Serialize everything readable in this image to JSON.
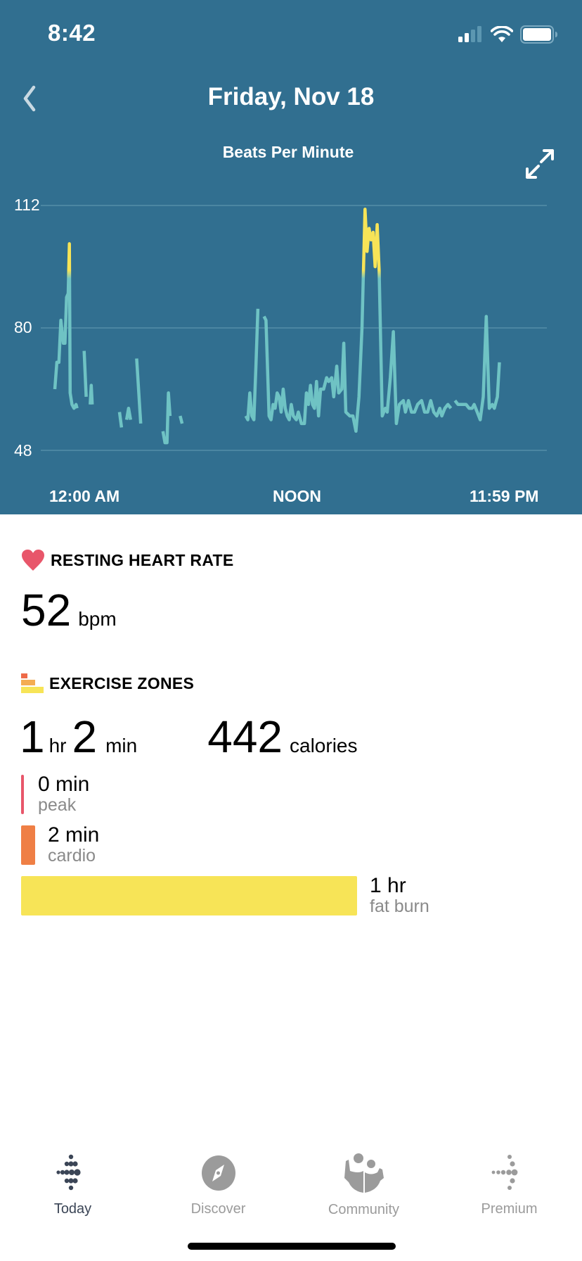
{
  "status_bar": {
    "time": "8:42",
    "signal_icon": "cellular-signal-icon",
    "wifi_icon": "wifi-icon",
    "battery_icon": "battery-icon"
  },
  "header": {
    "title": "Friday, Nov 18",
    "back_icon": "chevron-left-icon",
    "expand_icon": "expand-icon"
  },
  "colors": {
    "hero_bg": "#316f90",
    "line": "#6fc3c4",
    "fat_burn": "#f7e457",
    "cardio": "#ef7f45",
    "peak": "#e8566a",
    "heart": "#e8566a",
    "grid": "#5b93ad"
  },
  "chart_data": {
    "type": "line",
    "title": "Beats Per Minute",
    "xlabel": "",
    "ylabel": "Beats Per Minute",
    "ylim": [
      48,
      112
    ],
    "xlim": [
      0,
      24
    ],
    "yticks": [
      112,
      80,
      48
    ],
    "xtick_labels": [
      "12:00 AM",
      "NOON",
      "11:59 PM"
    ],
    "xtick_hours": [
      0,
      12,
      24
    ],
    "grid": true,
    "fat_burn_threshold_bpm": 94,
    "series": [
      {
        "name": "heart rate",
        "segments": [
          [
            [
              0.0,
              64
            ],
            [
              0.1,
              71
            ],
            [
              0.2,
              71
            ],
            [
              0.3,
              82
            ],
            [
              0.42,
              76
            ],
            [
              0.5,
              76
            ],
            [
              0.58,
              88
            ],
            [
              0.66,
              89
            ],
            [
              0.72,
              102
            ],
            [
              0.76,
              63
            ],
            [
              0.85,
              60
            ],
            [
              0.95,
              59
            ],
            [
              1.05,
              60
            ],
            [
              1.1,
              59
            ]
          ],
          [
            [
              1.45,
              74
            ],
            [
              1.55,
              62
            ]
          ],
          [
            [
              1.75,
              60
            ],
            [
              1.8,
              65
            ],
            [
              1.85,
              60
            ]
          ],
          [
            [
              3.2,
              58
            ],
            [
              3.3,
              54
            ]
          ],
          [
            [
              3.55,
              56
            ],
            [
              3.65,
              59
            ],
            [
              3.75,
              56
            ]
          ],
          [
            [
              4.05,
              72
            ],
            [
              4.25,
              55
            ]
          ],
          [
            [
              5.35,
              53
            ],
            [
              5.45,
              50
            ],
            [
              5.55,
              50
            ],
            [
              5.62,
              63
            ],
            [
              5.7,
              57
            ]
          ],
          [
            [
              6.2,
              57
            ],
            [
              6.3,
              55
            ]
          ],
          [
            [
              9.45,
              57
            ],
            [
              9.55,
              56
            ],
            [
              9.65,
              63
            ],
            [
              9.75,
              57
            ],
            [
              9.85,
              56
            ],
            [
              9.95,
              70
            ],
            [
              10.05,
              85
            ]
          ],
          [
            [
              10.35,
              83
            ],
            [
              10.45,
              82
            ],
            [
              10.6,
              57
            ],
            [
              10.7,
              56
            ],
            [
              10.8,
              60
            ],
            [
              10.9,
              59
            ],
            [
              11.0,
              63
            ],
            [
              11.1,
              62
            ],
            [
              11.2,
              58
            ],
            [
              11.3,
              64
            ],
            [
              11.4,
              59
            ],
            [
              11.5,
              57
            ],
            [
              11.6,
              56
            ],
            [
              11.7,
              60
            ],
            [
              11.8,
              57
            ],
            [
              11.95,
              56
            ],
            [
              12.05,
              58
            ],
            [
              12.2,
              55
            ],
            [
              12.35,
              55
            ],
            [
              12.45,
              63
            ],
            [
              12.55,
              60
            ],
            [
              12.65,
              65
            ],
            [
              12.75,
              60
            ],
            [
              12.85,
              59
            ],
            [
              12.95,
              66
            ],
            [
              13.05,
              57
            ],
            [
              13.15,
              64
            ],
            [
              13.3,
              64
            ],
            [
              13.45,
              67
            ],
            [
              13.55,
              66
            ],
            [
              13.7,
              67
            ],
            [
              13.8,
              62
            ],
            [
              13.95,
              70
            ],
            [
              14.05,
              63
            ],
            [
              14.2,
              64
            ],
            [
              14.3,
              76
            ],
            [
              14.4,
              58
            ],
            [
              14.6,
              57
            ],
            [
              14.75,
              57
            ],
            [
              14.9,
              53
            ],
            [
              15.05,
              62
            ],
            [
              15.2,
              80
            ],
            [
              15.35,
              111
            ],
            [
              15.45,
              100
            ],
            [
              15.55,
              106
            ],
            [
              15.65,
              103
            ],
            [
              15.75,
              105
            ],
            [
              15.85,
              96
            ],
            [
              15.95,
              107
            ],
            [
              16.05,
              95
            ],
            [
              16.2,
              57
            ],
            [
              16.35,
              59
            ],
            [
              16.45,
              58
            ],
            [
              16.6,
              67
            ],
            [
              16.75,
              79
            ],
            [
              16.9,
              55
            ],
            [
              17.05,
              60
            ],
            [
              17.25,
              61
            ],
            [
              17.35,
              58
            ],
            [
              17.5,
              61
            ],
            [
              17.65,
              58
            ],
            [
              17.8,
              58
            ],
            [
              17.95,
              60
            ],
            [
              18.15,
              61
            ],
            [
              18.3,
              58
            ],
            [
              18.45,
              58
            ],
            [
              18.6,
              61
            ],
            [
              18.75,
              58
            ],
            [
              18.9,
              57
            ],
            [
              19.05,
              59
            ],
            [
              19.15,
              57
            ],
            [
              19.3,
              59
            ],
            [
              19.45,
              60
            ],
            [
              19.6,
              59
            ]
          ],
          [
            [
              19.8,
              61
            ],
            [
              19.95,
              60
            ],
            [
              20.15,
              60
            ],
            [
              20.35,
              60
            ],
            [
              20.5,
              59
            ],
            [
              20.65,
              59
            ],
            [
              20.75,
              60
            ],
            [
              20.9,
              58
            ],
            [
              21.05,
              56
            ],
            [
              21.2,
              62
            ],
            [
              21.35,
              83
            ],
            [
              21.5,
              59
            ],
            [
              21.65,
              60
            ],
            [
              21.75,
              59
            ],
            [
              21.9,
              62
            ],
            [
              22.0,
              71
            ]
          ]
        ]
      }
    ]
  },
  "resting_heart_rate": {
    "title": "RESTING HEART RATE",
    "icon": "heart-icon",
    "value": "52",
    "unit": "bpm"
  },
  "exercise_zones": {
    "title": "EXERCISE ZONES",
    "icon": "zones-icon",
    "total_hours": "1",
    "hours_unit": "hr",
    "total_minutes": "2",
    "minutes_unit": "min",
    "calories": "442",
    "calories_unit": "calories",
    "zones": [
      {
        "value": "0 min",
        "name": "peak",
        "minutes": 0
      },
      {
        "value": "2 min",
        "name": "cardio",
        "minutes": 2
      },
      {
        "value": "1 hr",
        "name": "fat burn",
        "minutes": 60
      }
    ]
  },
  "tabbar": {
    "tabs": [
      {
        "label": "Today",
        "icon": "fitbit-logo-icon",
        "active": true
      },
      {
        "label": "Discover",
        "icon": "compass-icon",
        "active": false
      },
      {
        "label": "Community",
        "icon": "community-people-icon",
        "active": false
      },
      {
        "label": "Premium",
        "icon": "premium-icon",
        "active": false
      }
    ]
  }
}
